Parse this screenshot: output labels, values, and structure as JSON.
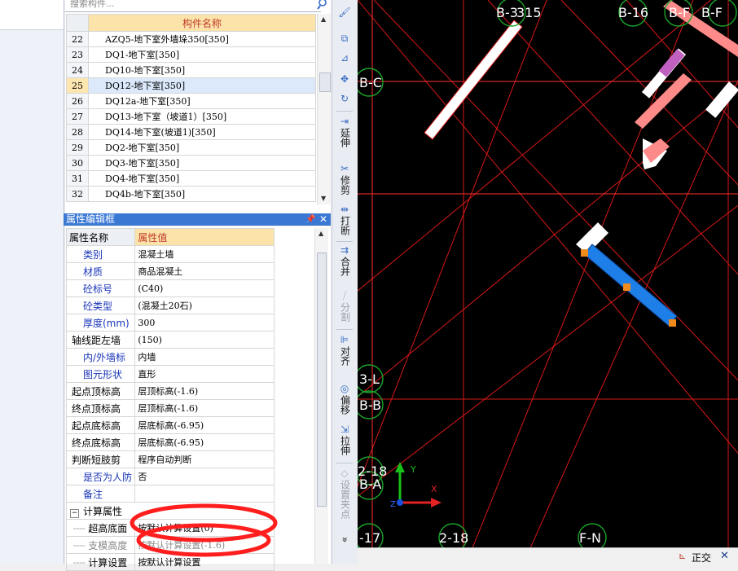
{
  "search": {
    "placeholder": "搜索构件..."
  },
  "component_list": {
    "header": "构件名称",
    "rows": [
      {
        "num": "22",
        "name": "AZQ5-地下室外墙垛350[350]"
      },
      {
        "num": "23",
        "name": "DQ1-地下室[350]"
      },
      {
        "num": "24",
        "name": "DQ10-地下室[350]"
      },
      {
        "num": "25",
        "name": "DQ12-地下室[350]",
        "selected": true
      },
      {
        "num": "26",
        "name": "DQ12a-地下室[350]"
      },
      {
        "num": "27",
        "name": "DQ13-地下室（坡道1）[350]"
      },
      {
        "num": "28",
        "name": "DQ14-地下室(坡道1)[350]"
      },
      {
        "num": "29",
        "name": "DQ2-地下室[350]"
      },
      {
        "num": "30",
        "name": "DQ3-地下室[350]"
      },
      {
        "num": "31",
        "name": "DQ4-地下室[350]"
      },
      {
        "num": "32",
        "name": "DQ4b-地下室[350]"
      }
    ]
  },
  "property_panel": {
    "title": "属性编辑框",
    "pin_icon": "pin-icon",
    "close_icon": "close-icon",
    "header_name": "属性名称",
    "header_value": "属性值",
    "rows": [
      {
        "key": "类别",
        "value": "混凝土墙",
        "blue": true
      },
      {
        "key": "材质",
        "value": "商品混凝土",
        "blue": true
      },
      {
        "key": "砼标号",
        "value": "(C40)",
        "blue": true
      },
      {
        "key": "砼类型",
        "value": "(混凝土20石)",
        "blue": true
      },
      {
        "key": "厚度(mm)",
        "value": "300",
        "blue": true
      },
      {
        "key": "轴线距左墙",
        "value": "(150)",
        "blue": false
      },
      {
        "key": "内/外墙标",
        "value": "内墙",
        "blue": true
      },
      {
        "key": "图元形状",
        "value": "直形",
        "blue": true
      },
      {
        "key": "起点顶标高",
        "value": "层顶标高(-1.6)",
        "blue": false
      },
      {
        "key": "终点顶标高",
        "value": "层顶标高(-1.6)",
        "blue": false
      },
      {
        "key": "起点底标高",
        "value": "层底标高(-6.95)",
        "blue": false
      },
      {
        "key": "终点底标高",
        "value": "层底标高(-6.95)",
        "blue": false
      },
      {
        "key": "判断短肢剪",
        "value": "程序自动判断",
        "blue": false
      },
      {
        "key": "是否为人防",
        "value": "否",
        "blue": true
      },
      {
        "key": "备注",
        "value": "",
        "blue": true
      }
    ],
    "group": {
      "toggle": "−",
      "label": "计算属性"
    },
    "sub_rows": [
      {
        "key": "超高底面",
        "value": "按默认计算设置(0)",
        "gray": false
      },
      {
        "key": "支模高度",
        "value": "按默认计算设置(-1.6)",
        "gray": true
      },
      {
        "key": "计算设置",
        "value": "按默认计算设置",
        "gray": false
      }
    ]
  },
  "toolbar": {
    "buttons": [
      {
        "label": "",
        "icon": "brush-icon"
      },
      {
        "label": "",
        "icon": "copy-icon"
      },
      {
        "label": "",
        "icon": "mirror-icon"
      },
      {
        "label": "",
        "icon": "move-icon"
      },
      {
        "label": "",
        "icon": "rotate-icon"
      },
      {
        "label": "延伸",
        "icon": "extend-icon"
      },
      {
        "label": "修剪",
        "icon": "trim-icon"
      },
      {
        "label": "打断",
        "icon": "break-icon"
      },
      {
        "label": "合并",
        "icon": "merge-icon"
      },
      {
        "label": "分割",
        "icon": "split-icon"
      },
      {
        "label": "对齐",
        "icon": "align-icon"
      },
      {
        "label": "偏移",
        "icon": "offset-icon"
      },
      {
        "label": "拉伸",
        "icon": "stretch-icon"
      },
      {
        "label": "设置夹点",
        "icon": "grip-icon"
      }
    ],
    "more": "»"
  },
  "canvas": {
    "axis_labels": [
      "B-3",
      "315",
      "B-16",
      "B-F",
      "B-F",
      "B-C",
      "3-L",
      "B-B",
      "2-18",
      "B-A",
      "-17",
      "2-18",
      "F-N"
    ],
    "ucs": {
      "x": "X",
      "y": "Y",
      "z": "Z"
    },
    "colors": {
      "background": "#000000",
      "grid": "#e01010",
      "wall": "#ffffff",
      "selected_wall": "#1e7fe8",
      "grip": "#f08a1c",
      "axis_circle": "#1aa52a"
    }
  },
  "status": {
    "text": "正交"
  }
}
